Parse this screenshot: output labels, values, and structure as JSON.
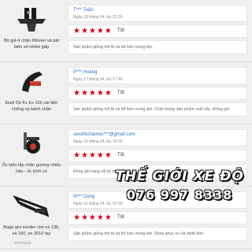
{
  "rating_label": "Tốt",
  "stars": "★★★★★",
  "reviews": [
    {
      "product": "Bộ giá 4 chân Winner và pát biển số nhôm gấp",
      "user": "T*** Tuấn",
      "date": "Ngày 18 tháng 04, lúc 22:16",
      "comment": "Sản phẩm giống mô tả và tốt hơn mong đợi."
    },
    {
      "product": "Đuôi Dè Fz Ex 150 cải tiến chống cạ bánh chắn",
      "user": "P*** Hoàng",
      "date": "Ngày 17 tháng 04, lúc 17:49",
      "comment": "Sản phẩm giống mô tả và tốt hơn mong đợi. Chất lượng sản phẩm xuất sắc. Đóng gói"
    },
    {
      "product": "Ốc kiểu lắp chân gương chiếu hậu - ốc kính có",
      "user": "sieuthichamso***@gmail.com",
      "date": "Ngày 14 tháng 04, lúc 15:32",
      "comment": "Đóng gói hàng rất kỹ và chắc chắn"
    },
    {
      "product": "Baga givi exciter cho ex 135, ex 150, ex 2010 tay",
      "user": "N*** Dũng",
      "date": "Ngày 12 tháng 04, lúc 07:59",
      "comment": "Sản phẩm giống mô tả và tốt hơn mong đợi. Shop phục vụ rất nhiệt tình."
    }
  ],
  "watermark": {
    "title": "THẾ GIỚI XE ĐỘ",
    "phone": "076 997 8338",
    "faint": "shshopvn"
  }
}
